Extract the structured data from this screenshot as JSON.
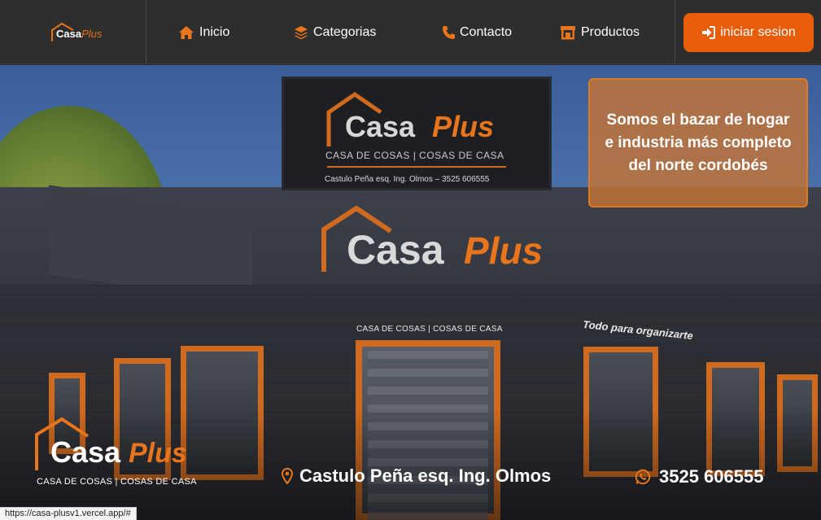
{
  "brand": {
    "name_primary": "Casa",
    "name_secondary": "Plus"
  },
  "nav": {
    "items": [
      {
        "label": "Inicio",
        "icon": "home-icon"
      },
      {
        "label": "Categorias",
        "icon": "layers-icon"
      },
      {
        "label": "Contacto",
        "icon": "phone-icon"
      },
      {
        "label": "Productos",
        "icon": "store-icon"
      }
    ],
    "login": {
      "label": "iniciar sesion",
      "icon": "sign-in-icon"
    }
  },
  "hero": {
    "tall_sign": {
      "primary": "Casa",
      "secondary": "Plus",
      "tagline": "CASA DE COSAS  |  COSAS DE CASA",
      "address": "Castulo Peña esq. Ing. Olmos  –  3525  606555"
    },
    "building_sign": {
      "primary": "Casa",
      "secondary": "Plus"
    },
    "facade_label": "CASA DE COSAS  |  COSAS DE CASA",
    "facade_script": "Todo para organizarte",
    "info_text": "Somos el bazar de hogar e industria más completo del norte cordobés",
    "bottom_logo": {
      "primary": "Casa",
      "secondary": "Plus",
      "tagline": "CASA DE COSAS  |  COSAS DE CASA"
    },
    "address": "Castulo Peña esq. Ing. Olmos",
    "phone": "3525  606555"
  },
  "status_bar": {
    "url": "https://casa-plusv1.vercel.app/#"
  },
  "colors": {
    "accent": "#e85d0a",
    "navbar": "#2e2e2e",
    "orange_box": "#c47434"
  }
}
